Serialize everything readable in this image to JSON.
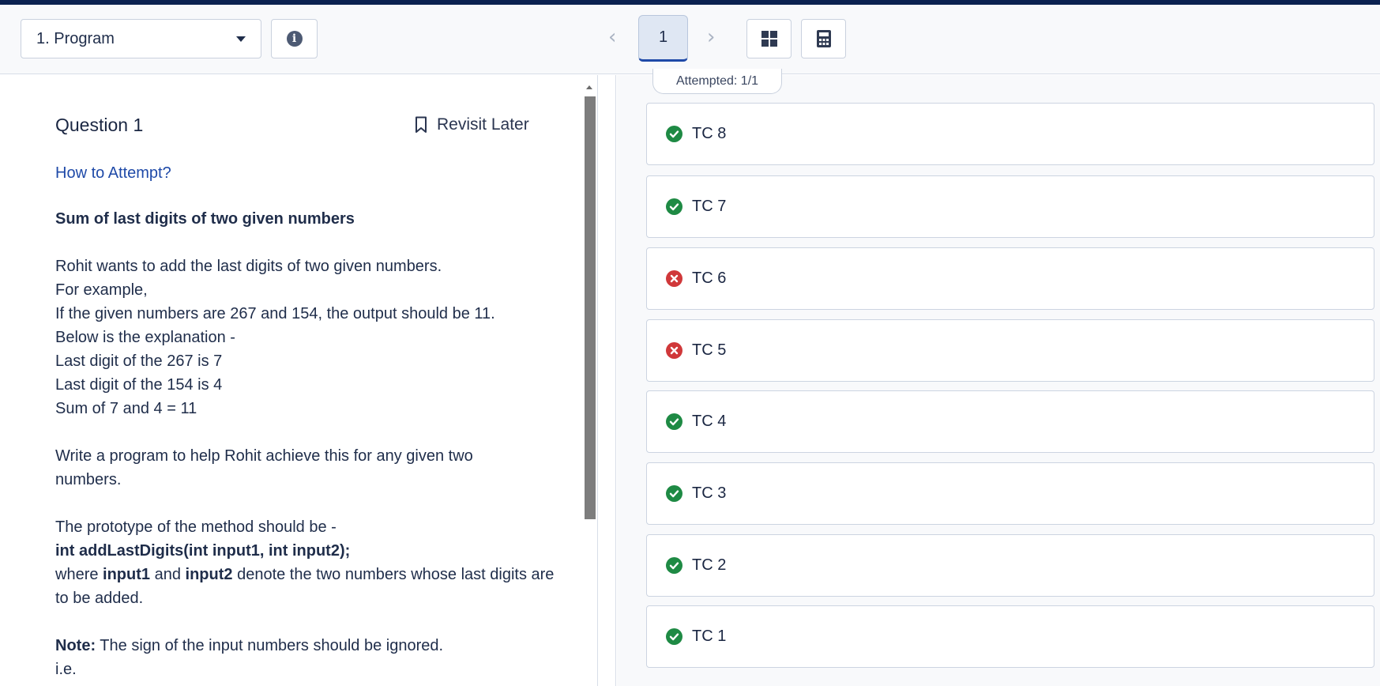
{
  "toolbar": {
    "section_select_value": "1. Program",
    "page_number": "1",
    "prev_label": "‹",
    "next_label": "›"
  },
  "question": {
    "title": "Question 1",
    "revisit_label": "Revisit Later",
    "how_to_label": "How to Attempt?",
    "heading": "Sum of last digits of two given numbers",
    "lines_block1": [
      "Rohit wants to add the last digits of two given numbers.",
      "For example,",
      "If the given numbers are 267 and 154, the output should be 11.",
      "Below is the explanation -",
      "Last digit of the 267 is 7",
      "Last digit of the 154 is 4",
      "Sum of 7 and 4 = 11"
    ],
    "write_program": "Write a program to help Rohit achieve this for any given two numbers.",
    "prototype_intro": "The prototype of the method should be -",
    "prototype": "int addLastDigits(int input1, int input2);",
    "where_prefix": "where ",
    "input1": "input1",
    "and_text": " and ",
    "input2": "input2",
    "where_suffix": " denote the two numbers whose last digits are to be added.",
    "note_label": "Note:",
    "note_text": " The sign of the input numbers should be ignored.",
    "ie": "i.e."
  },
  "results": {
    "attempted_label": "Attempted: 1/1",
    "test_cases": [
      {
        "label": "TC 8",
        "status": "pass"
      },
      {
        "label": "TC 7",
        "status": "pass"
      },
      {
        "label": "TC 6",
        "status": "fail"
      },
      {
        "label": "TC 5",
        "status": "fail"
      },
      {
        "label": "TC 4",
        "status": "pass"
      },
      {
        "label": "TC 3",
        "status": "pass"
      },
      {
        "label": "TC 2",
        "status": "pass"
      },
      {
        "label": "TC 1",
        "status": "pass"
      }
    ]
  },
  "colors": {
    "pass": "#1e8a44",
    "fail": "#d0383a",
    "accent": "#1f4aa8",
    "top_strip": "#0b2150"
  }
}
